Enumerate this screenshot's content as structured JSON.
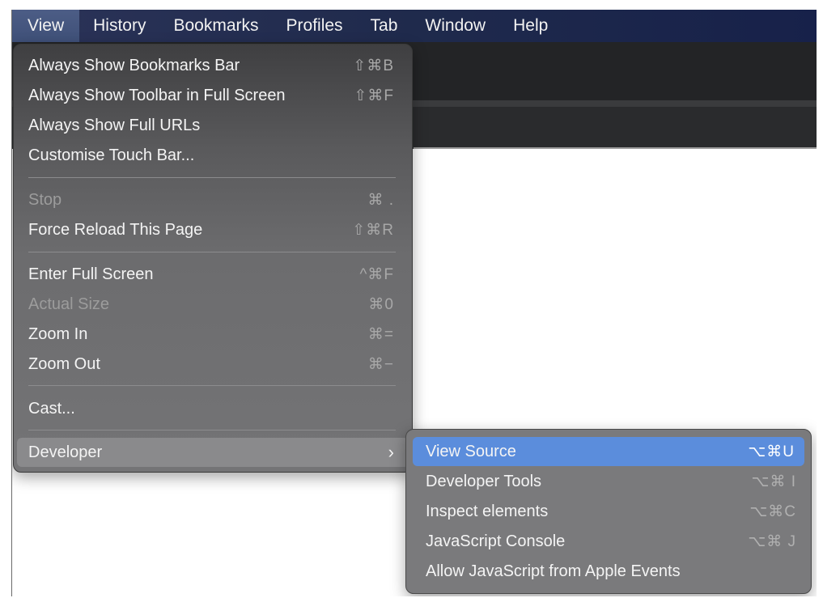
{
  "menubar": {
    "items": [
      {
        "label": "View",
        "active": true
      },
      {
        "label": "History"
      },
      {
        "label": "Bookmarks"
      },
      {
        "label": "Profiles"
      },
      {
        "label": "Tab"
      },
      {
        "label": "Window"
      },
      {
        "label": "Help"
      }
    ]
  },
  "view_menu": {
    "items": [
      {
        "label": "Always Show Bookmarks Bar",
        "shortcut": "⇧⌘B",
        "enabled": true
      },
      {
        "label": "Always Show Toolbar in Full Screen",
        "shortcut": "⇧⌘F",
        "enabled": true
      },
      {
        "label": "Always Show Full URLs",
        "shortcut": "",
        "enabled": true
      },
      {
        "label": "Customise Touch Bar...",
        "shortcut": "",
        "enabled": true
      },
      {
        "label": "Stop",
        "shortcut": "⌘ .",
        "enabled": false
      },
      {
        "label": "Force Reload This Page",
        "shortcut": "⇧⌘R",
        "enabled": true
      },
      {
        "label": "Enter Full Screen",
        "shortcut": "^⌘F",
        "enabled": true
      },
      {
        "label": "Actual Size",
        "shortcut": "⌘0",
        "enabled": false
      },
      {
        "label": "Zoom In",
        "shortcut": "⌘=",
        "enabled": true
      },
      {
        "label": "Zoom Out",
        "shortcut": "⌘−",
        "enabled": true
      },
      {
        "label": "Cast...",
        "shortcut": "",
        "enabled": true
      },
      {
        "label": "Developer",
        "shortcut": "",
        "enabled": true,
        "submenu_indicator": "›"
      }
    ]
  },
  "developer_submenu": {
    "items": [
      {
        "label": "View Source",
        "shortcut": "⌥⌘U",
        "highlighted": true
      },
      {
        "label": "Developer Tools",
        "shortcut": "⌥⌘ I"
      },
      {
        "label": "Inspect elements",
        "shortcut": "⌥⌘C"
      },
      {
        "label": "JavaScript Console",
        "shortcut": "⌥⌘ J"
      },
      {
        "label": "Allow JavaScript from Apple Events",
        "shortcut": ""
      }
    ]
  },
  "colors": {
    "menubar_bg": "#1f2a4c",
    "menu_highlight": "#5b8ddc",
    "menu_selected": "#8a8a8c"
  }
}
